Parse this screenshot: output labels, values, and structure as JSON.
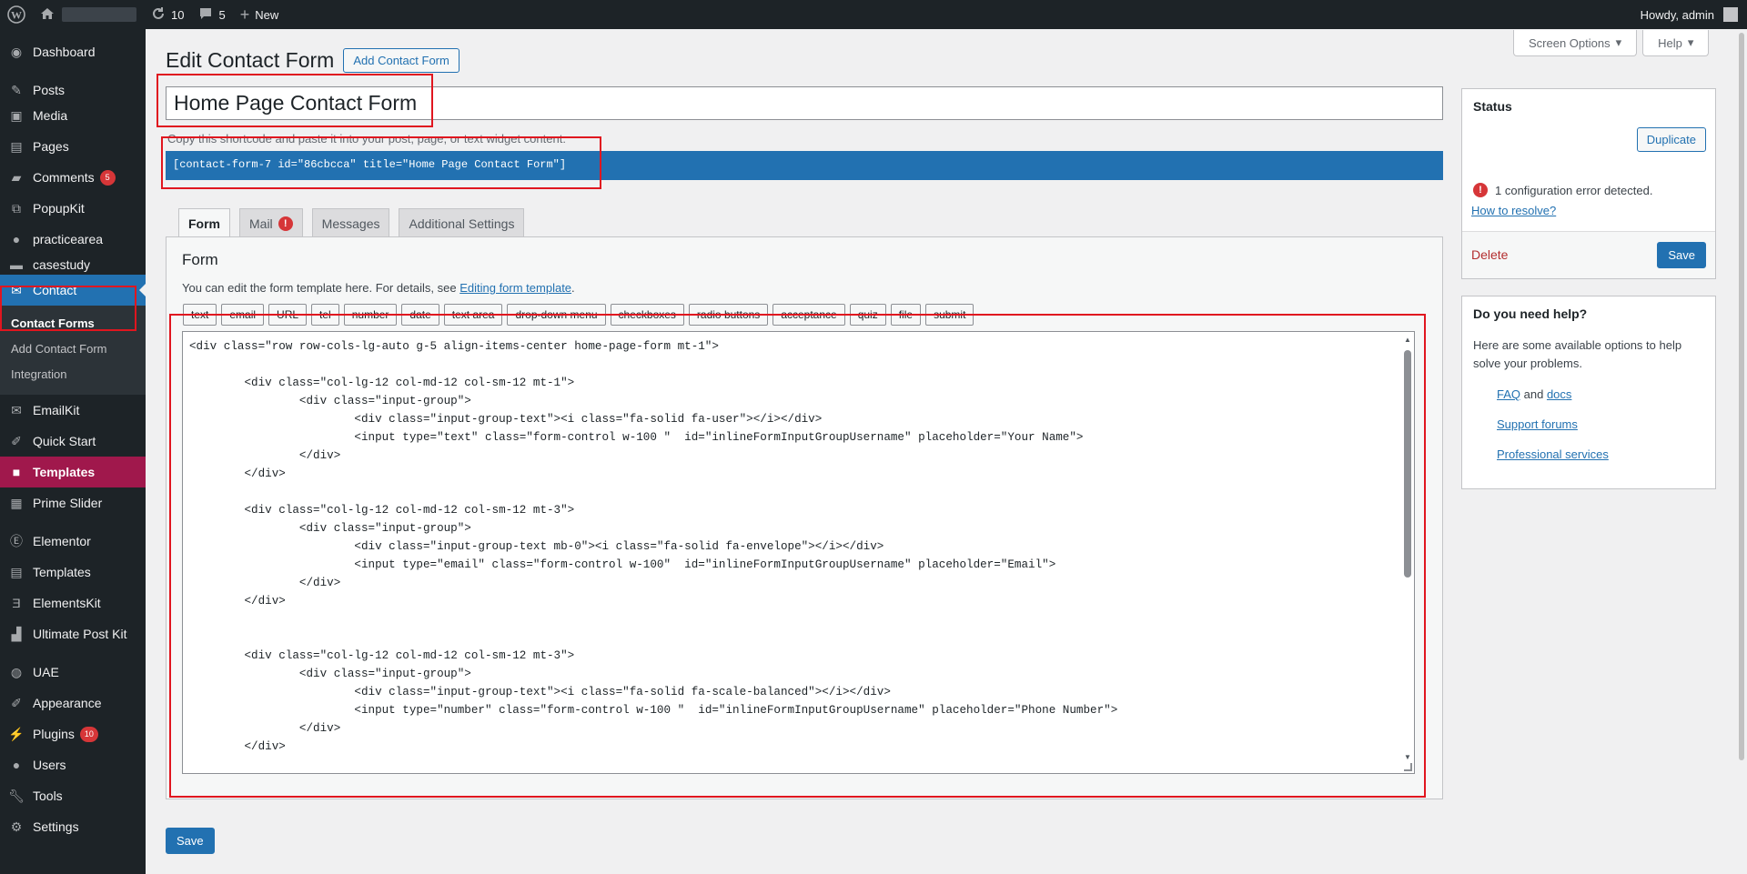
{
  "adminbar": {
    "updates_count": "10",
    "comments_count": "5",
    "new_label": "New",
    "howdy": "Howdy, admin"
  },
  "sidebar": {
    "items": [
      {
        "label": "Dashboard",
        "icon": "dashboard-icon"
      },
      {
        "label": "Posts",
        "icon": "pin-icon"
      },
      {
        "label": "Media",
        "icon": "media-icon"
      },
      {
        "label": "Pages",
        "icon": "pages-icon"
      },
      {
        "label": "Comments",
        "icon": "comment-icon",
        "badge": "5"
      },
      {
        "label": "PopupKit",
        "icon": "popupkit-icon"
      },
      {
        "label": "practicearea",
        "icon": "user-icon"
      },
      {
        "label": "casestudy",
        "icon": "folder-icon"
      },
      {
        "label": "Contact",
        "icon": "mail-icon"
      },
      {
        "label": "EmailKit",
        "icon": "emailkit-icon"
      },
      {
        "label": "Quick Start",
        "icon": "brush-icon"
      },
      {
        "label": "Templates",
        "icon": "templates-icon"
      },
      {
        "label": "Prime Slider",
        "icon": "slider-icon"
      },
      {
        "label": "Elementor",
        "icon": "elementor-icon"
      },
      {
        "label": "Templates",
        "icon": "folder-icon"
      },
      {
        "label": "ElementsKit",
        "icon": "elementskit-icon"
      },
      {
        "label": "Ultimate Post Kit",
        "icon": "postkit-icon"
      },
      {
        "label": "UAE",
        "icon": "uae-icon"
      },
      {
        "label": "Appearance",
        "icon": "brush-icon"
      },
      {
        "label": "Plugins",
        "icon": "plugin-icon",
        "badge": "10"
      },
      {
        "label": "Users",
        "icon": "user-icon"
      },
      {
        "label": "Tools",
        "icon": "wrench-icon"
      },
      {
        "label": "Settings",
        "icon": "settings-icon"
      }
    ],
    "contact_sub": [
      "Contact Forms",
      "Add Contact Form",
      "Integration"
    ]
  },
  "header": {
    "screen_options": "Screen Options",
    "help": "Help",
    "title": "Edit Contact Form",
    "add_new": "Add Contact Form"
  },
  "form": {
    "title_value": "Home Page Contact Form",
    "shortcode_note": "Copy this shortcode and paste it into your post, page, or text widget content:",
    "shortcode": "[contact-form-7 id=\"86cbcca\" title=\"Home Page Contact Form\"]",
    "tabs": [
      "Form",
      "Mail",
      "Messages",
      "Additional Settings"
    ],
    "section_title": "Form",
    "desc_prefix": "You can edit the form template here. For details, see ",
    "desc_link": "Editing form template",
    "desc_suffix": ".",
    "tag_buttons": [
      "text",
      "email",
      "URL",
      "tel",
      "number",
      "date",
      "text area",
      "drop-down menu",
      "checkboxes",
      "radio buttons",
      "acceptance",
      "quiz",
      "file",
      "submit"
    ],
    "code": "<div class=\"row row-cols-lg-auto g-5 align-items-center home-page-form mt-1\">\n\n\t<div class=\"col-lg-12 col-md-12 col-sm-12 mt-1\">\n\t\t<div class=\"input-group\">\n\t\t\t<div class=\"input-group-text\"><i class=\"fa-solid fa-user\"></i></div>\n\t\t\t<input type=\"text\" class=\"form-control w-100 \"  id=\"inlineFormInputGroupUsername\" placeholder=\"Your Name\">\n\t\t</div>\n\t</div>\n\n\t<div class=\"col-lg-12 col-md-12 col-sm-12 mt-3\">\n\t\t<div class=\"input-group\">\n\t\t\t<div class=\"input-group-text mb-0\"><i class=\"fa-solid fa-envelope\"></i></div>\n\t\t\t<input type=\"email\" class=\"form-control w-100\"  id=\"inlineFormInputGroupUsername\" placeholder=\"Email\">\n\t\t</div>\n\t</div>\n\n\n\t<div class=\"col-lg-12 col-md-12 col-sm-12 mt-3\">\n\t\t<div class=\"input-group\">\n\t\t\t<div class=\"input-group-text\"><i class=\"fa-solid fa-scale-balanced\"></i></div>\n\t\t\t<input type=\"number\" class=\"form-control w-100 \"  id=\"inlineFormInputGroupUsername\" placeholder=\"Phone Number\">\n\t\t</div>\n\t</div>",
    "save": "Save"
  },
  "status": {
    "title": "Status",
    "duplicate": "Duplicate",
    "error": "1 configuration error detected.",
    "resolve": "How to resolve?",
    "delete": "Delete",
    "save": "Save"
  },
  "help": {
    "title": "Do you need help?",
    "text": "Here are some available options to help solve your problems.",
    "faq": "FAQ",
    "and": " and ",
    "docs": "docs",
    "support": "Support forums",
    "pro": "Professional services"
  }
}
